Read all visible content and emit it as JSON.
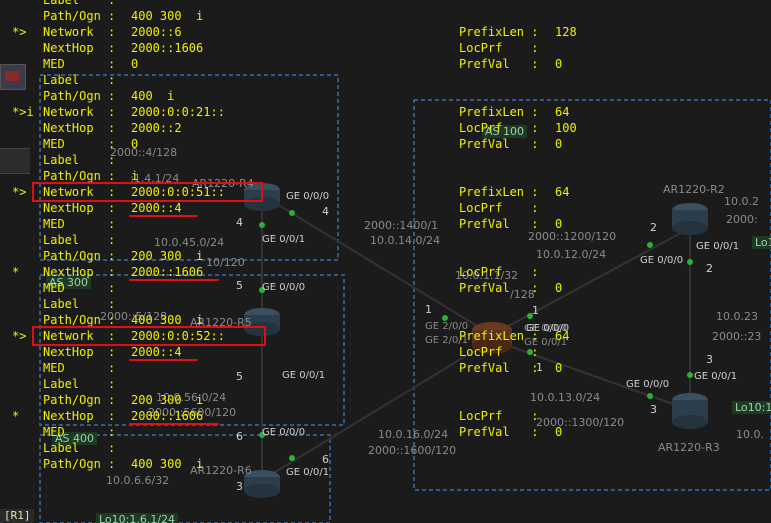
{
  "status_bar": {
    "prompt_label": "[R1]"
  },
  "topology": {
    "routers": {
      "r2": "AR1220-R2",
      "r3": "AR1220-R3",
      "r4": "AR1220-R4",
      "r5": "AR1220-R5",
      "r6": "AR1220-R6",
      "r1_ports": [
        "GE 2/0/0",
        "GE 2/0/1",
        "GE 0/0/0",
        "GE 0/0/1"
      ]
    },
    "labels": [
      "AS 300",
      "AS 400",
      "AS 100",
      "Lo10:1",
      "Lo10:1",
      "Lo10:1.6.1/24",
      "10.0.45.0/24",
      "10.0.56.0/24",
      "2000::5600/120",
      "10.0.6.6/32",
      "10.0.16.0/24",
      "2000::1600/120",
      "2000::1400/1",
      "10.0.14.0/24",
      "2000::1200/120",
      "10.0.12.0/24",
      "10.0.1.1/32",
      "10.0.13.0/24",
      "2000::1300/120",
      "10.0.2",
      "2000:",
      "10.0.23",
      "2000::23",
      "10.0.",
      "2000::4/128",
      "2000::5/128",
      ":1.4.1/24",
      "10/120",
      "/128",
      "GE 0/0/0",
      "GE 0/0/1",
      "GE 0/0/0",
      "GE 0/0/1",
      "GE 0/0/0",
      "GE 0/0/1",
      "GE 0/0/0",
      "GE 0/0/1",
      "GE 0/0/0",
      "GE 0/0/1",
      "GE 0/0/0",
      "1",
      "2",
      "3",
      "4",
      "4",
      "5",
      "5",
      "6",
      "6",
      "2",
      "3",
      "3",
      "1",
      "1"
    ]
  },
  "colors": {
    "terminal_text": "#f0f000",
    "highlight": "#e01010"
  },
  "bgp_routes": [
    {
      "status": "",
      "left": [
        [
          "Label",
          ""
        ],
        [
          "Path/Ogn",
          "400 300  i"
        ]
      ],
      "right": []
    },
    {
      "status": "*>",
      "left": [
        [
          "Network",
          "2000::6"
        ],
        [
          "NextHop",
          "2000::1606"
        ],
        [
          "MED",
          "0"
        ],
        [
          "Label",
          ""
        ],
        [
          "Path/Ogn",
          "400  i"
        ]
      ],
      "right": [
        [
          "PrefixLen",
          "128"
        ],
        [
          "LocPrf",
          ""
        ],
        [
          "PrefVal",
          "0"
        ]
      ]
    },
    {
      "status": "*>i",
      "left": [
        [
          "Network",
          "2000:0:0:21::"
        ],
        [
          "NextHop",
          "2000::2"
        ],
        [
          "MED",
          "0"
        ],
        [
          "Label",
          ""
        ],
        [
          "Path/Ogn",
          "i"
        ]
      ],
      "right": [
        [
          "PrefixLen",
          "64"
        ],
        [
          "LocPrf",
          "100"
        ],
        [
          "PrefVal",
          "0"
        ]
      ]
    },
    {
      "status": "*>",
      "left": [
        [
          "Network",
          "2000:0:0:51::"
        ],
        [
          "NextHop",
          "2000::4"
        ],
        [
          "MED",
          ""
        ],
        [
          "Label",
          ""
        ],
        [
          "Path/Ogn",
          "200 300  i"
        ]
      ],
      "right": [
        [
          "PrefixLen",
          "64"
        ],
        [
          "LocPrf",
          ""
        ],
        [
          "PrefVal",
          "0"
        ]
      ]
    },
    {
      "status": "*",
      "left": [
        [
          "NextHop",
          "2000::1606"
        ],
        [
          "MED",
          ""
        ],
        [
          "Label",
          ""
        ],
        [
          "Path/Ogn",
          "400 300  i"
        ]
      ],
      "right": [
        [
          "LocPrf",
          ""
        ],
        [
          "PrefVal",
          "0"
        ]
      ]
    },
    {
      "status": "*>",
      "left": [
        [
          "Network",
          "2000:0:0:52::"
        ],
        [
          "NextHop",
          "2000::4"
        ],
        [
          "MED",
          ""
        ],
        [
          "Label",
          ""
        ],
        [
          "Path/Ogn",
          "200 300  i"
        ]
      ],
      "right": [
        [
          "PrefixLen",
          "64"
        ],
        [
          "LocPrf",
          ""
        ],
        [
          "PrefVal",
          "0"
        ]
      ]
    },
    {
      "status": "*",
      "left": [
        [
          "NextHop",
          "2000::1606"
        ],
        [
          "MED",
          ""
        ],
        [
          "Label",
          ""
        ],
        [
          "Path/Ogn",
          "400 300  i"
        ]
      ],
      "right": [
        [
          "LocPrf",
          ""
        ],
        [
          "PrefVal",
          "0"
        ]
      ]
    }
  ]
}
